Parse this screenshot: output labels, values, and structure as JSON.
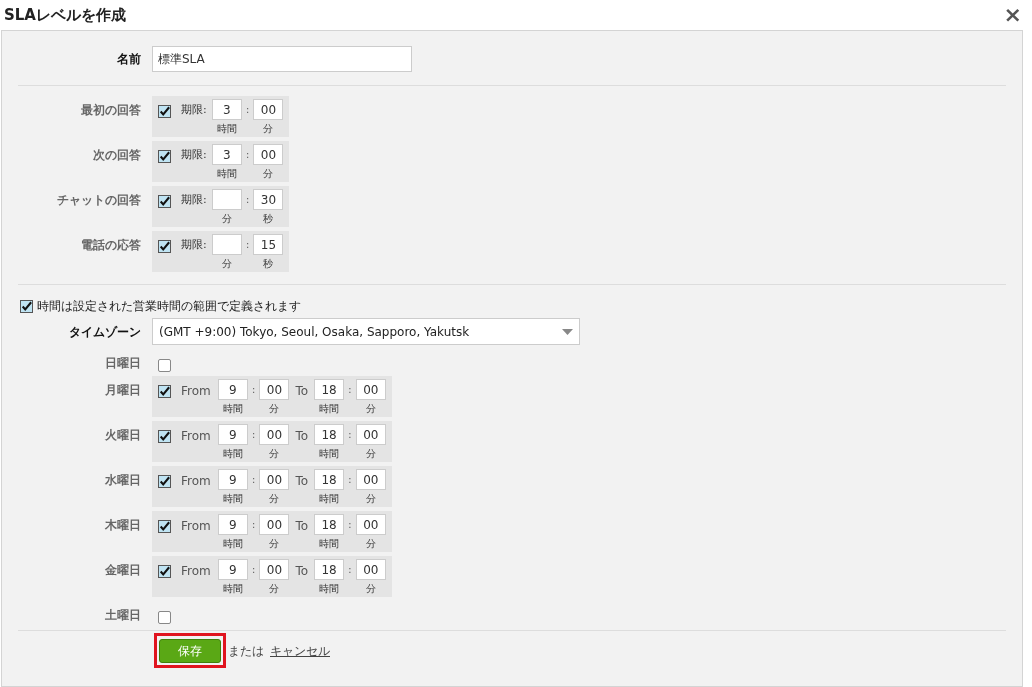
{
  "window": {
    "title": "SLAレベルを作成",
    "close": "×"
  },
  "name_field": {
    "label": "名前",
    "value": "標準SLA"
  },
  "sla_targets": [
    {
      "label": "最初の回答",
      "checked": true,
      "prefix": "期限:",
      "separator": ":",
      "fields": [
        {
          "value": "3",
          "unit": "時間"
        },
        {
          "value": "00",
          "unit": "分"
        }
      ]
    },
    {
      "label": "次の回答",
      "checked": true,
      "prefix": "期限:",
      "separator": ":",
      "fields": [
        {
          "value": "3",
          "unit": "時間"
        },
        {
          "value": "00",
          "unit": "分"
        }
      ]
    },
    {
      "label": "チャットの回答",
      "checked": true,
      "prefix": "期限:",
      "separator": ":",
      "fields": [
        {
          "unit": "分"
        },
        {
          "value": "30",
          "unit": "秒"
        }
      ]
    },
    {
      "label": "電話の応答",
      "checked": true,
      "prefix": "期限:",
      "separator": ":",
      "fields": [
        {
          "unit": "分"
        },
        {
          "value": "15",
          "unit": "秒"
        }
      ]
    }
  ],
  "business_hours": {
    "label": "時間は設定された営業時間の範囲で定義されます",
    "checked": true
  },
  "timezone": {
    "label": "タイムゾーン",
    "value": "(GMT +9:00) Tokyo, Seoul, Osaka, Sapporo, Yakutsk"
  },
  "days": [
    {
      "label": "日曜日",
      "checked": false
    },
    {
      "label": "月曜日",
      "checked": true,
      "from_label": "From",
      "to_label": "To",
      "separator": ":",
      "fields": [
        {
          "value": "9",
          "unit": "時間"
        },
        {
          "value": "00",
          "unit": "分"
        },
        {
          "value": "18",
          "unit": "時間"
        },
        {
          "value": "00",
          "unit": "分"
        }
      ]
    },
    {
      "label": "火曜日",
      "checked": true,
      "from_label": "From",
      "to_label": "To",
      "separator": ":",
      "fields": [
        {
          "value": "9",
          "unit": "時間"
        },
        {
          "value": "00",
          "unit": "分"
        },
        {
          "value": "18",
          "unit": "時間"
        },
        {
          "value": "00",
          "unit": "分"
        }
      ]
    },
    {
      "label": "水曜日",
      "checked": true,
      "from_label": "From",
      "to_label": "To",
      "separator": ":",
      "fields": [
        {
          "value": "9",
          "unit": "時間"
        },
        {
          "value": "00",
          "unit": "分"
        },
        {
          "value": "18",
          "unit": "時間"
        },
        {
          "value": "00",
          "unit": "分"
        }
      ]
    },
    {
      "label": "木曜日",
      "checked": true,
      "from_label": "From",
      "to_label": "To",
      "separator": ":",
      "fields": [
        {
          "value": "9",
          "unit": "時間"
        },
        {
          "value": "00",
          "unit": "分"
        },
        {
          "value": "18",
          "unit": "時間"
        },
        {
          "value": "00",
          "unit": "分"
        }
      ]
    },
    {
      "label": "金曜日",
      "checked": true,
      "from_label": "From",
      "to_label": "To",
      "separator": ":",
      "fields": [
        {
          "value": "9",
          "unit": "時間"
        },
        {
          "value": "00",
          "unit": "分"
        },
        {
          "value": "18",
          "unit": "時間"
        },
        {
          "value": "00",
          "unit": "分"
        }
      ]
    },
    {
      "label": "土曜日",
      "checked": false
    }
  ],
  "footer": {
    "save": "保存",
    "save_highlighted": true,
    "or_text": "または",
    "cancel": "キャンセル"
  }
}
